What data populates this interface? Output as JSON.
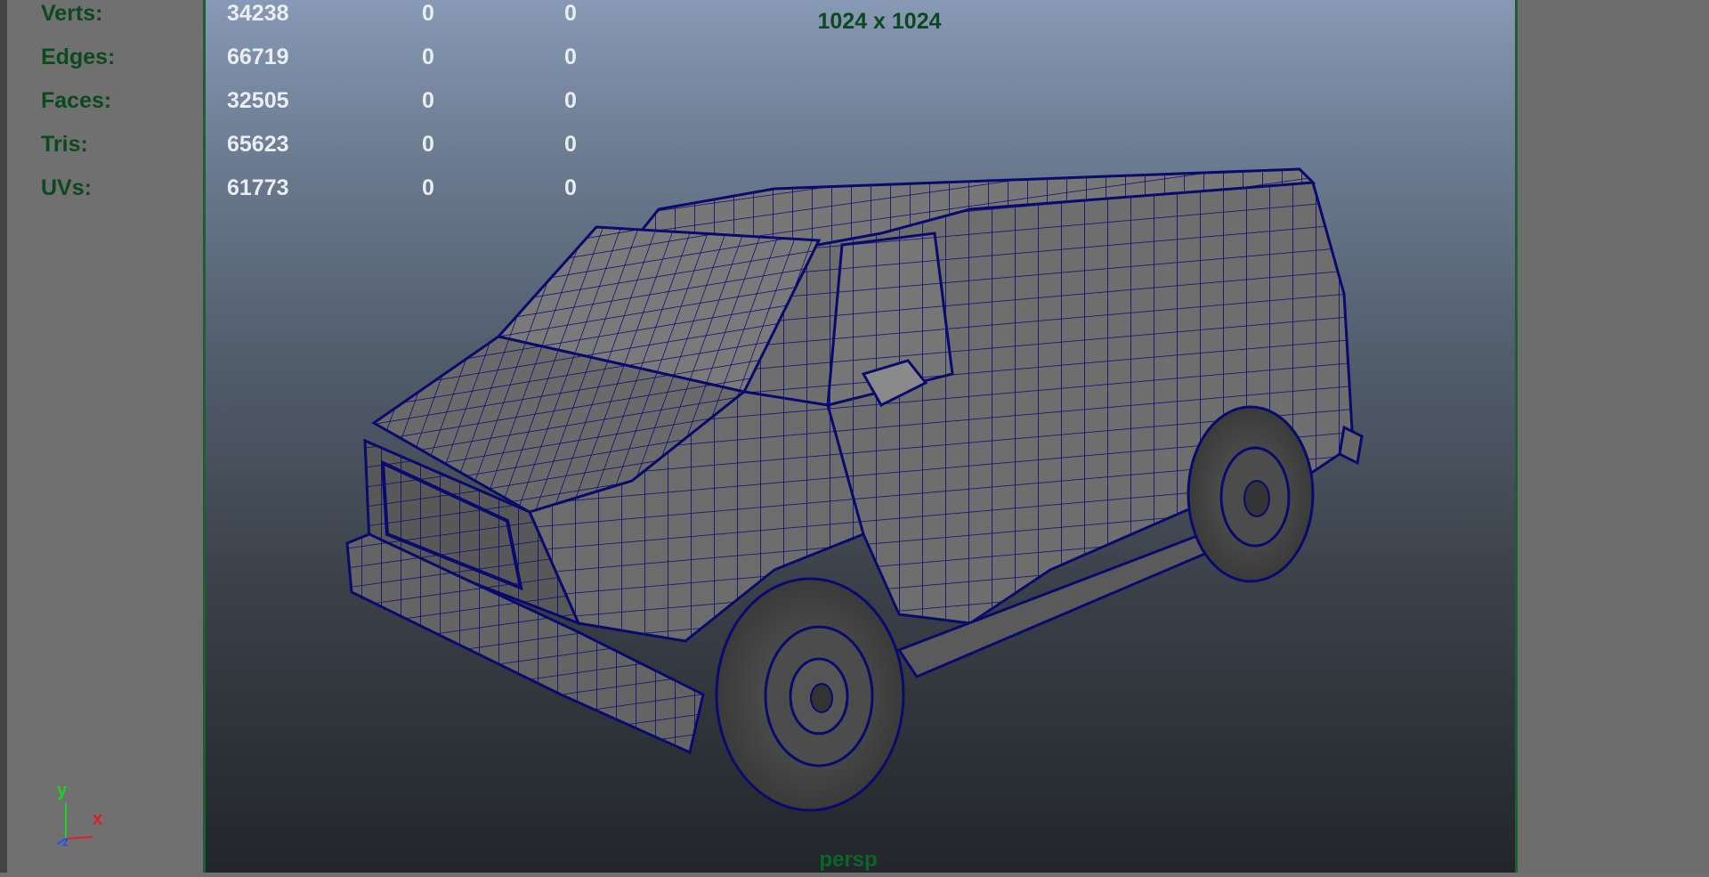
{
  "hud": {
    "rows": [
      {
        "label": "Verts:",
        "values": [
          "34238",
          "0",
          "0"
        ]
      },
      {
        "label": "Edges:",
        "values": [
          "66719",
          "0",
          "0"
        ]
      },
      {
        "label": "Faces:",
        "values": [
          "32505",
          "0",
          "0"
        ]
      },
      {
        "label": "Tris:",
        "values": [
          "65623",
          "0",
          "0"
        ]
      },
      {
        "label": "UVs:",
        "values": [
          "61773",
          "0",
          "0"
        ]
      }
    ]
  },
  "viewport": {
    "resolution": "1024 x 1024",
    "camera": "persp",
    "wire_color": "#0a0a6e",
    "shade_color": "#6e6e6e",
    "frame_color": "#1f5e33",
    "label_color": "#0b4a1f"
  },
  "axis": {
    "y_label": "y",
    "x_label": "x",
    "z_label": "z",
    "y_color": "#1dd31d",
    "x_color": "#e02020",
    "z_color": "#2a4cff"
  }
}
